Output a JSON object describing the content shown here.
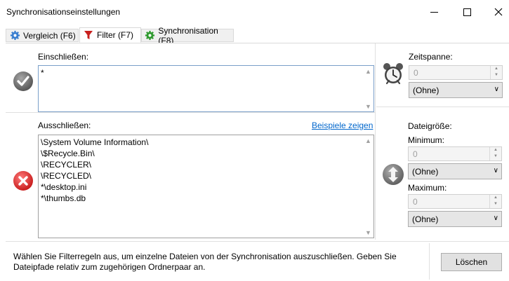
{
  "window": {
    "title": "Synchronisationseinstellungen"
  },
  "tabs": [
    {
      "label": "Vergleich (F6)",
      "icon": "gear-icon",
      "active": false
    },
    {
      "label": "Filter (F7)",
      "icon": "funnel-icon",
      "active": true
    },
    {
      "label": "Synchronisation (F8)",
      "icon": "gear-green-icon",
      "active": false
    }
  ],
  "include": {
    "label": "Einschließen:",
    "value": "*"
  },
  "exclude": {
    "label": "Ausschließen:",
    "examples_link": "Beispiele zeigen",
    "lines": [
      "\\System Volume Information\\",
      "\\$Recycle.Bin\\",
      "\\RECYCLER\\",
      "\\RECYCLED\\",
      "*\\desktop.ini",
      "*\\thumbs.db"
    ]
  },
  "timespan": {
    "label": "Zeitspanne:",
    "value": "0",
    "unit": "(Ohne)"
  },
  "filesize": {
    "label": "Dateigröße:",
    "min_label": "Minimum:",
    "min_value": "0",
    "min_unit": "(Ohne)",
    "max_label": "Maximum:",
    "max_value": "0",
    "max_unit": "(Ohne)"
  },
  "footer": {
    "info": "Wählen Sie Filterregeln aus, um einzelne Dateien von der Synchronisation auszuschließen. Geben Sie Dateipfade relativ zum zugehörigen Ordnerpaar an.",
    "clear_button": "Löschen"
  },
  "colors": {
    "link": "#0066cc",
    "focus_border": "#7a9fc9",
    "exclude_red": "#e03030"
  }
}
